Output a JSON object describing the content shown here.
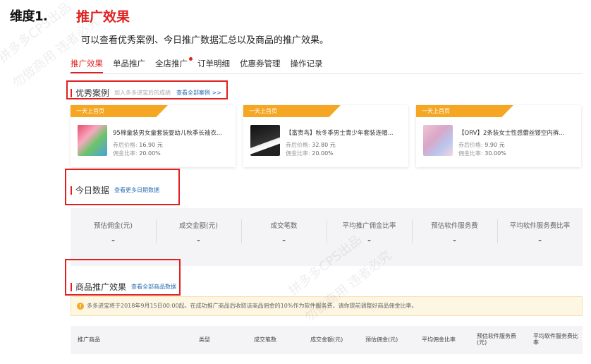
{
  "heading": {
    "dimension_label": "维度1.",
    "title": "推广效果",
    "description": "可以查看优秀案例、今日推广数据汇总以及商品的推广效果。"
  },
  "tabs": [
    {
      "label": "推广效果",
      "active": true
    },
    {
      "label": "单品推广"
    },
    {
      "label": "全店推广",
      "dot": true
    },
    {
      "label": "订单明细"
    },
    {
      "label": "优惠券管理"
    },
    {
      "label": "操作记录"
    }
  ],
  "cases": {
    "title": "优秀案例",
    "subtitle": "加入多多进宝后的成绩",
    "link": "查看全部案例 >>",
    "items": [
      {
        "flag": "一天上首页",
        "name": "95棉童装男女童套装婴幼儿秋季长袖衣...",
        "price_label": "券后价格:",
        "price": "16.90 元",
        "rate_label": "佣金比率:",
        "rate": "20.00%",
        "thumb_color": "#e84c6a"
      },
      {
        "flag": "一天上首页",
        "name": "【富贵鸟】秋冬季男士青少年套装连帽...",
        "price_label": "券后价格:",
        "price": "32.80 元",
        "rate_label": "佣金比率:",
        "rate": "20.00%",
        "thumb_color": "#222222"
      },
      {
        "flag": "一天上首页",
        "name": "【ORV】2条装女士性感蕾丝镂空内裤...",
        "price_label": "券后价格:",
        "price": "9.90 元",
        "rate_label": "佣金比率:",
        "rate": "30.00%",
        "thumb_color": "#f0c4d4"
      }
    ]
  },
  "today": {
    "title": "今日数据",
    "link": "查看更多日期数据",
    "stats": [
      {
        "label": "预估佣金(元)",
        "value": "-"
      },
      {
        "label": "成交金额(元)",
        "value": "-"
      },
      {
        "label": "成交笔数",
        "value": "-"
      },
      {
        "label": "平均推广佣金比率",
        "value": "-"
      },
      {
        "label": "预估软件服务费",
        "value": "-"
      },
      {
        "label": "平均软件服务费比率",
        "value": "-"
      }
    ]
  },
  "product_effect": {
    "title": "商品推广效果",
    "link": "查看全部商品数据",
    "notice_icon": "!",
    "notice": "多多进宝将于2018年9月15日00:00起，在成功推广商品后收取该商品佣金的10%作为软件服务费，请你提前调整好商品佣金比率。",
    "columns": [
      "推广商品",
      "类型",
      "成交笔数",
      "成交金额(元)",
      "预估佣金(元)",
      "平均佣金比率",
      "预估软件服务费(元)",
      "平均软件服务费比率"
    ]
  },
  "watermark": [
    "拼多多CPS出品",
    "勿做商用 违者必究"
  ],
  "colors": {
    "accent": "#e02020",
    "flag": "#f5a623",
    "link": "#2b6cb0"
  }
}
